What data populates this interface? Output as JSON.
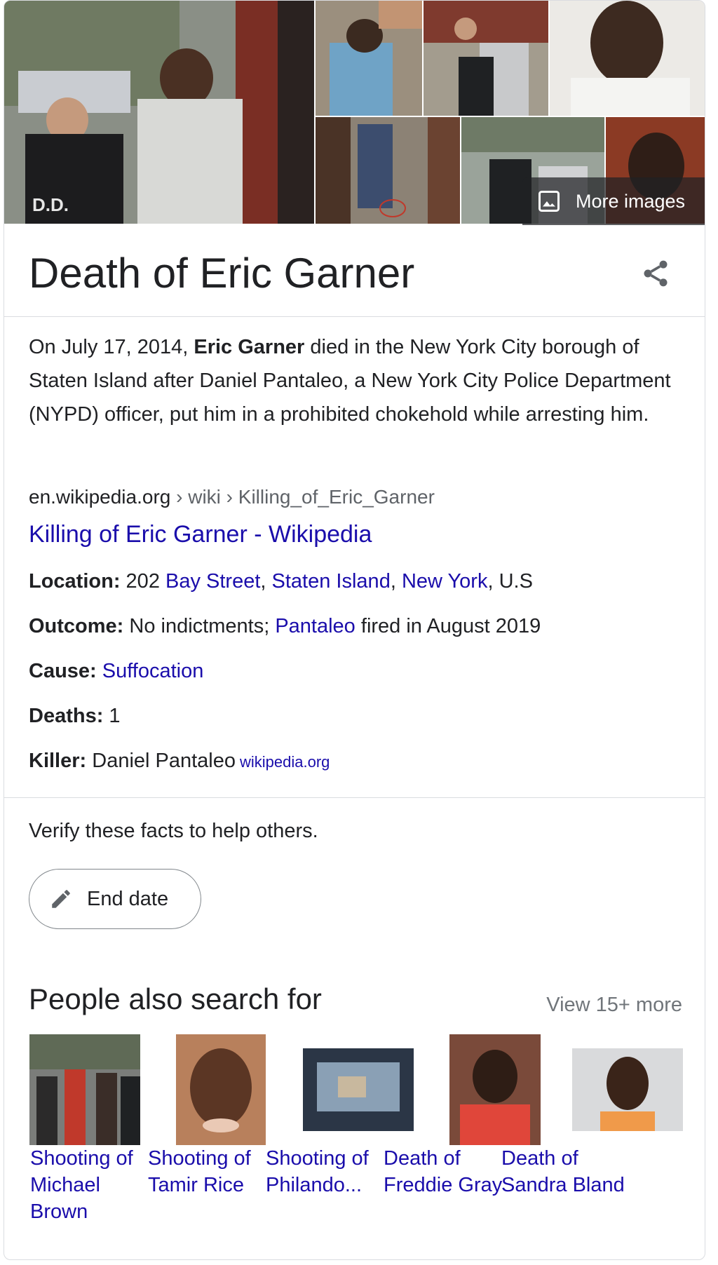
{
  "images": {
    "more_images_label": "More images"
  },
  "title": "Death of Eric Garner",
  "description": {
    "before": "On July 17, 2014, ",
    "bold": "Eric Garner",
    "after": " died in the New York City borough of Staten Island after Daniel Pantaleo, a New York City Police Department (NYPD) officer, put him in a prohibited chokehold while arresting him."
  },
  "source": {
    "domain": "en.wikipedia.org",
    "crumbs": " › wiki › Killing_of_Eric_Garner",
    "link_text": "Killing of Eric Garner - Wikipedia"
  },
  "facts": {
    "location": {
      "label": "Location:",
      "prefix": " 202 ",
      "link1": "Bay Street",
      "sep1": ", ",
      "link2": "Staten Island",
      "sep2": ", ",
      "link3": "New York",
      "suffix": ", U.S"
    },
    "outcome": {
      "label": "Outcome:",
      "prefix": " No indictments; ",
      "link": "Pantaleo",
      "suffix": " fired in August 2019"
    },
    "cause": {
      "label": "Cause:",
      "link": "Suffocation"
    },
    "deaths": {
      "label": "Deaths:",
      "value": " 1"
    },
    "killer": {
      "label": "Killer:",
      "value": " Daniel Pantaleo",
      "source": "wikipedia.org"
    }
  },
  "verify": {
    "text": "Verify these facts to help others.",
    "button": "End date"
  },
  "people_also_search": {
    "heading": "People also search for",
    "view_more": "View 15+ more",
    "items": [
      {
        "label": "Shooting of Michael Brown"
      },
      {
        "label": "Shooting of Tamir Rice"
      },
      {
        "label": "Shooting of Philando..."
      },
      {
        "label": "Death of Freddie Gray"
      },
      {
        "label": "Death of Sandra Bland"
      }
    ]
  },
  "icons": [
    "image-icon",
    "share-icon",
    "pencil-icon"
  ]
}
